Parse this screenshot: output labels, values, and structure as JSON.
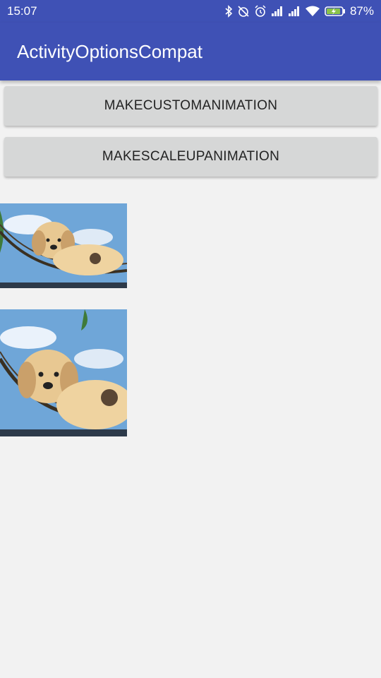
{
  "status_bar": {
    "time": "15:07",
    "battery_percent": "87%",
    "icons": [
      "bluetooth-icon",
      "alarm-off-icon",
      "alarm-clock-icon",
      "signal-icon",
      "signal-icon",
      "wifi-icon",
      "battery-charging-icon"
    ]
  },
  "app_bar": {
    "title": "ActivityOptionsCompat"
  },
  "buttons": [
    {
      "label": "MAKECUSTOMANIMATION"
    },
    {
      "label": "MAKESCALEUPANIMATION"
    }
  ],
  "images": [
    {
      "subject": "puppy in hammock"
    },
    {
      "subject": "puppy in hammock"
    }
  ],
  "colors": {
    "primary": "#3f51b5",
    "button": "#d6d7d7",
    "background": "#f2f2f2"
  }
}
